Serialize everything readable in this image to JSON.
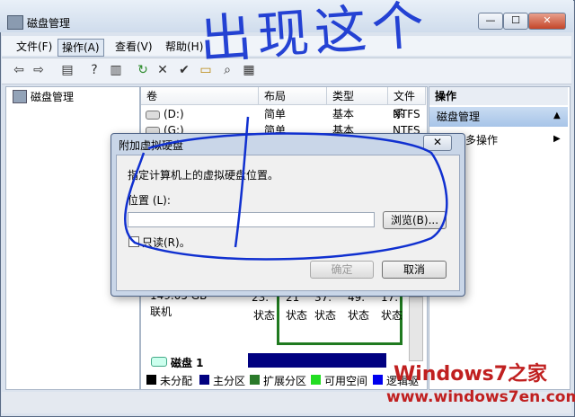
{
  "window": {
    "title": "磁盘管理",
    "min": "—",
    "max": "☐",
    "close": "✕"
  },
  "menu": [
    "文件(F)",
    "操作(A)",
    "查看(V)",
    "帮助(H)"
  ],
  "annotation_text": "出现这个",
  "tree": {
    "root": "磁盘管理"
  },
  "volumes": {
    "columns": [
      "卷",
      "布局",
      "类型",
      "文件系"
    ],
    "rows": [
      {
        "name": "(D:)",
        "layout": "简单",
        "type": "基本",
        "fs": "NTFS"
      },
      {
        "name": "(G:)",
        "layout": "简单",
        "type": "基本",
        "fs": "NTFS"
      }
    ]
  },
  "actions": {
    "header": "操作",
    "item": "磁盘管理",
    "more": "更多操作"
  },
  "disk": {
    "capacity": "149.05 GB",
    "status": "联机",
    "partitions": [
      {
        "size": "23.",
        "status": "状态"
      },
      {
        "size": "21",
        "status": "状态"
      },
      {
        "size": "37.",
        "status": "状态"
      },
      {
        "size": "49.",
        "status": "状态"
      },
      {
        "size": "17.",
        "status": "状态"
      }
    ],
    "disk_label": "磁盘 1"
  },
  "legend": [
    {
      "label": "未分配",
      "color": "#000000"
    },
    {
      "label": "主分区",
      "color": "#000080"
    },
    {
      "label": "扩展分区",
      "color": "#2a7a2a"
    },
    {
      "label": "可用空间",
      "color": "#22dd22"
    },
    {
      "label": "逻辑驱",
      "color": "#0000ee"
    }
  ],
  "dialog": {
    "title": "附加虚拟硬盘",
    "close": "✕",
    "prompt": "指定计算机上的虚拟硬盘位置。",
    "location_label": "位置 (L):",
    "location_value": "",
    "browse": "浏览(B)...",
    "readonly": "只读(R)。",
    "ok": "确定",
    "cancel": "取消"
  },
  "watermark": {
    "brand": "Windows7之家",
    "url": "www.windows7en.com"
  }
}
